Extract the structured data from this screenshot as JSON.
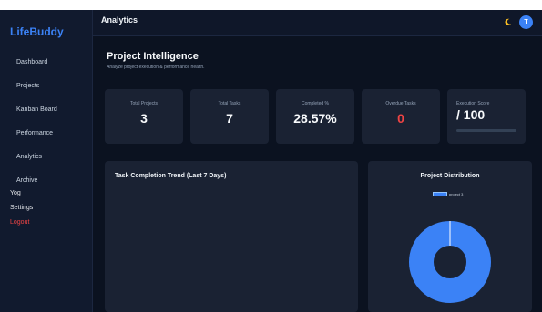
{
  "brand": "LifeBuddy",
  "nav": [
    "Dashboard",
    "Projects",
    "Kanban Board",
    "Performance",
    "Analytics",
    "Archive"
  ],
  "nav_extra": {
    "yog": "Yog",
    "settings": "Settings",
    "logout": "Logout"
  },
  "topbar": {
    "title": "Analytics",
    "avatar_initial": "T"
  },
  "page": {
    "title": "Project Intelligence",
    "subtitle": "Analyze project execution & performance health."
  },
  "stats": [
    {
      "label": "Total Projects",
      "value": "3"
    },
    {
      "label": "Total Tasks",
      "value": "7"
    },
    {
      "label": "Completed %",
      "value": "28.57%"
    },
    {
      "label": "Overdue Tasks",
      "value": "0"
    },
    {
      "label": "Execution Score",
      "value": "/ 100"
    }
  ],
  "execution_score_fill": 0,
  "trend_panel": {
    "title": "Task Completion Trend (Last 7 Days)"
  },
  "distribution_panel": {
    "title": "Project Distribution",
    "legend": "project 3",
    "slices": [
      {
        "label": "project 3",
        "value": 100,
        "color": "#3b82f6"
      }
    ]
  },
  "colors": {
    "accent": "#3b82f6",
    "danger": "#ef4444",
    "background": "#0b1220",
    "card": "#1a2233"
  },
  "icons": {
    "theme": "moon-icon"
  }
}
